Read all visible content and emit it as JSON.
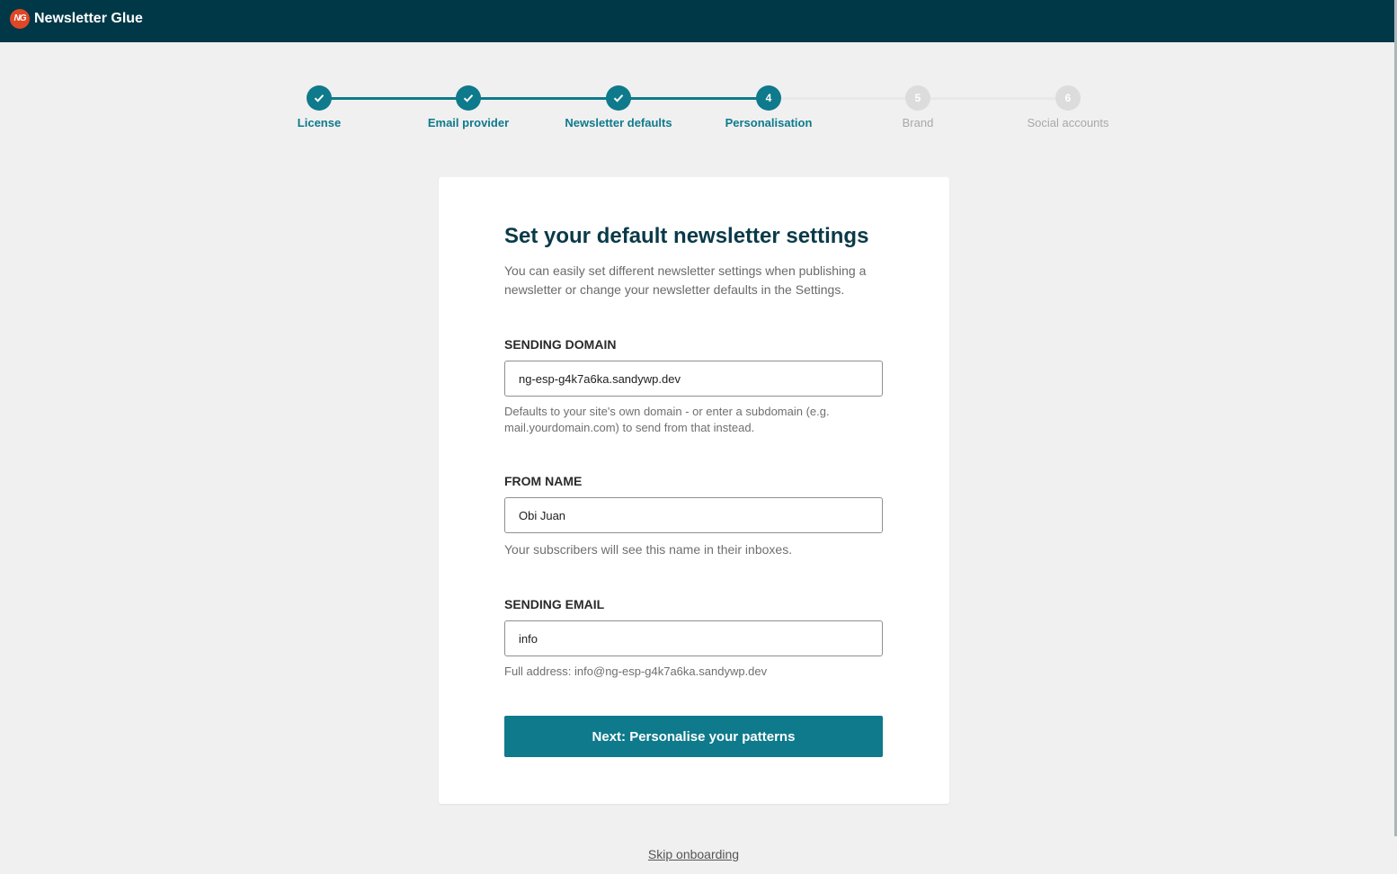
{
  "header": {
    "logo_badge": "NG",
    "title": "Newsletter Glue"
  },
  "steps": [
    {
      "label": "License",
      "status": "done"
    },
    {
      "label": "Email provider",
      "status": "done"
    },
    {
      "label": "Newsletter defaults",
      "status": "done"
    },
    {
      "label": "Personalisation",
      "number": "4",
      "status": "active"
    },
    {
      "label": "Brand",
      "number": "5",
      "status": "todo"
    },
    {
      "label": "Social accounts",
      "number": "6",
      "status": "todo"
    }
  ],
  "form": {
    "heading": "Set your default newsletter settings",
    "intro": "You can easily set different newsletter settings when publishing a newsletter or change your newsletter defaults in the Settings.",
    "sending_domain": {
      "label": "SENDING DOMAIN",
      "value": "ng-esp-g4k7a6ka.sandywp.dev",
      "help": "Defaults to your site's own domain - or enter a subdomain (e.g. mail.yourdomain.com) to send from that instead."
    },
    "from_name": {
      "label": "FROM NAME",
      "value": "Obi Juan",
      "help": "Your subscribers will see this name in their inboxes."
    },
    "sending_email": {
      "label": "SENDING EMAIL",
      "value": "info",
      "help": "Full address: info@ng-esp-g4k7a6ka.sandywp.dev"
    },
    "next_button": "Next: Personalise your patterns"
  },
  "skip_link": "Skip onboarding",
  "colors": {
    "topbar": "#013848",
    "accent": "#0e7a8c",
    "logo": "#df4727",
    "background": "#f0f0f0"
  },
  "icons": {
    "done_step": "check-icon"
  }
}
